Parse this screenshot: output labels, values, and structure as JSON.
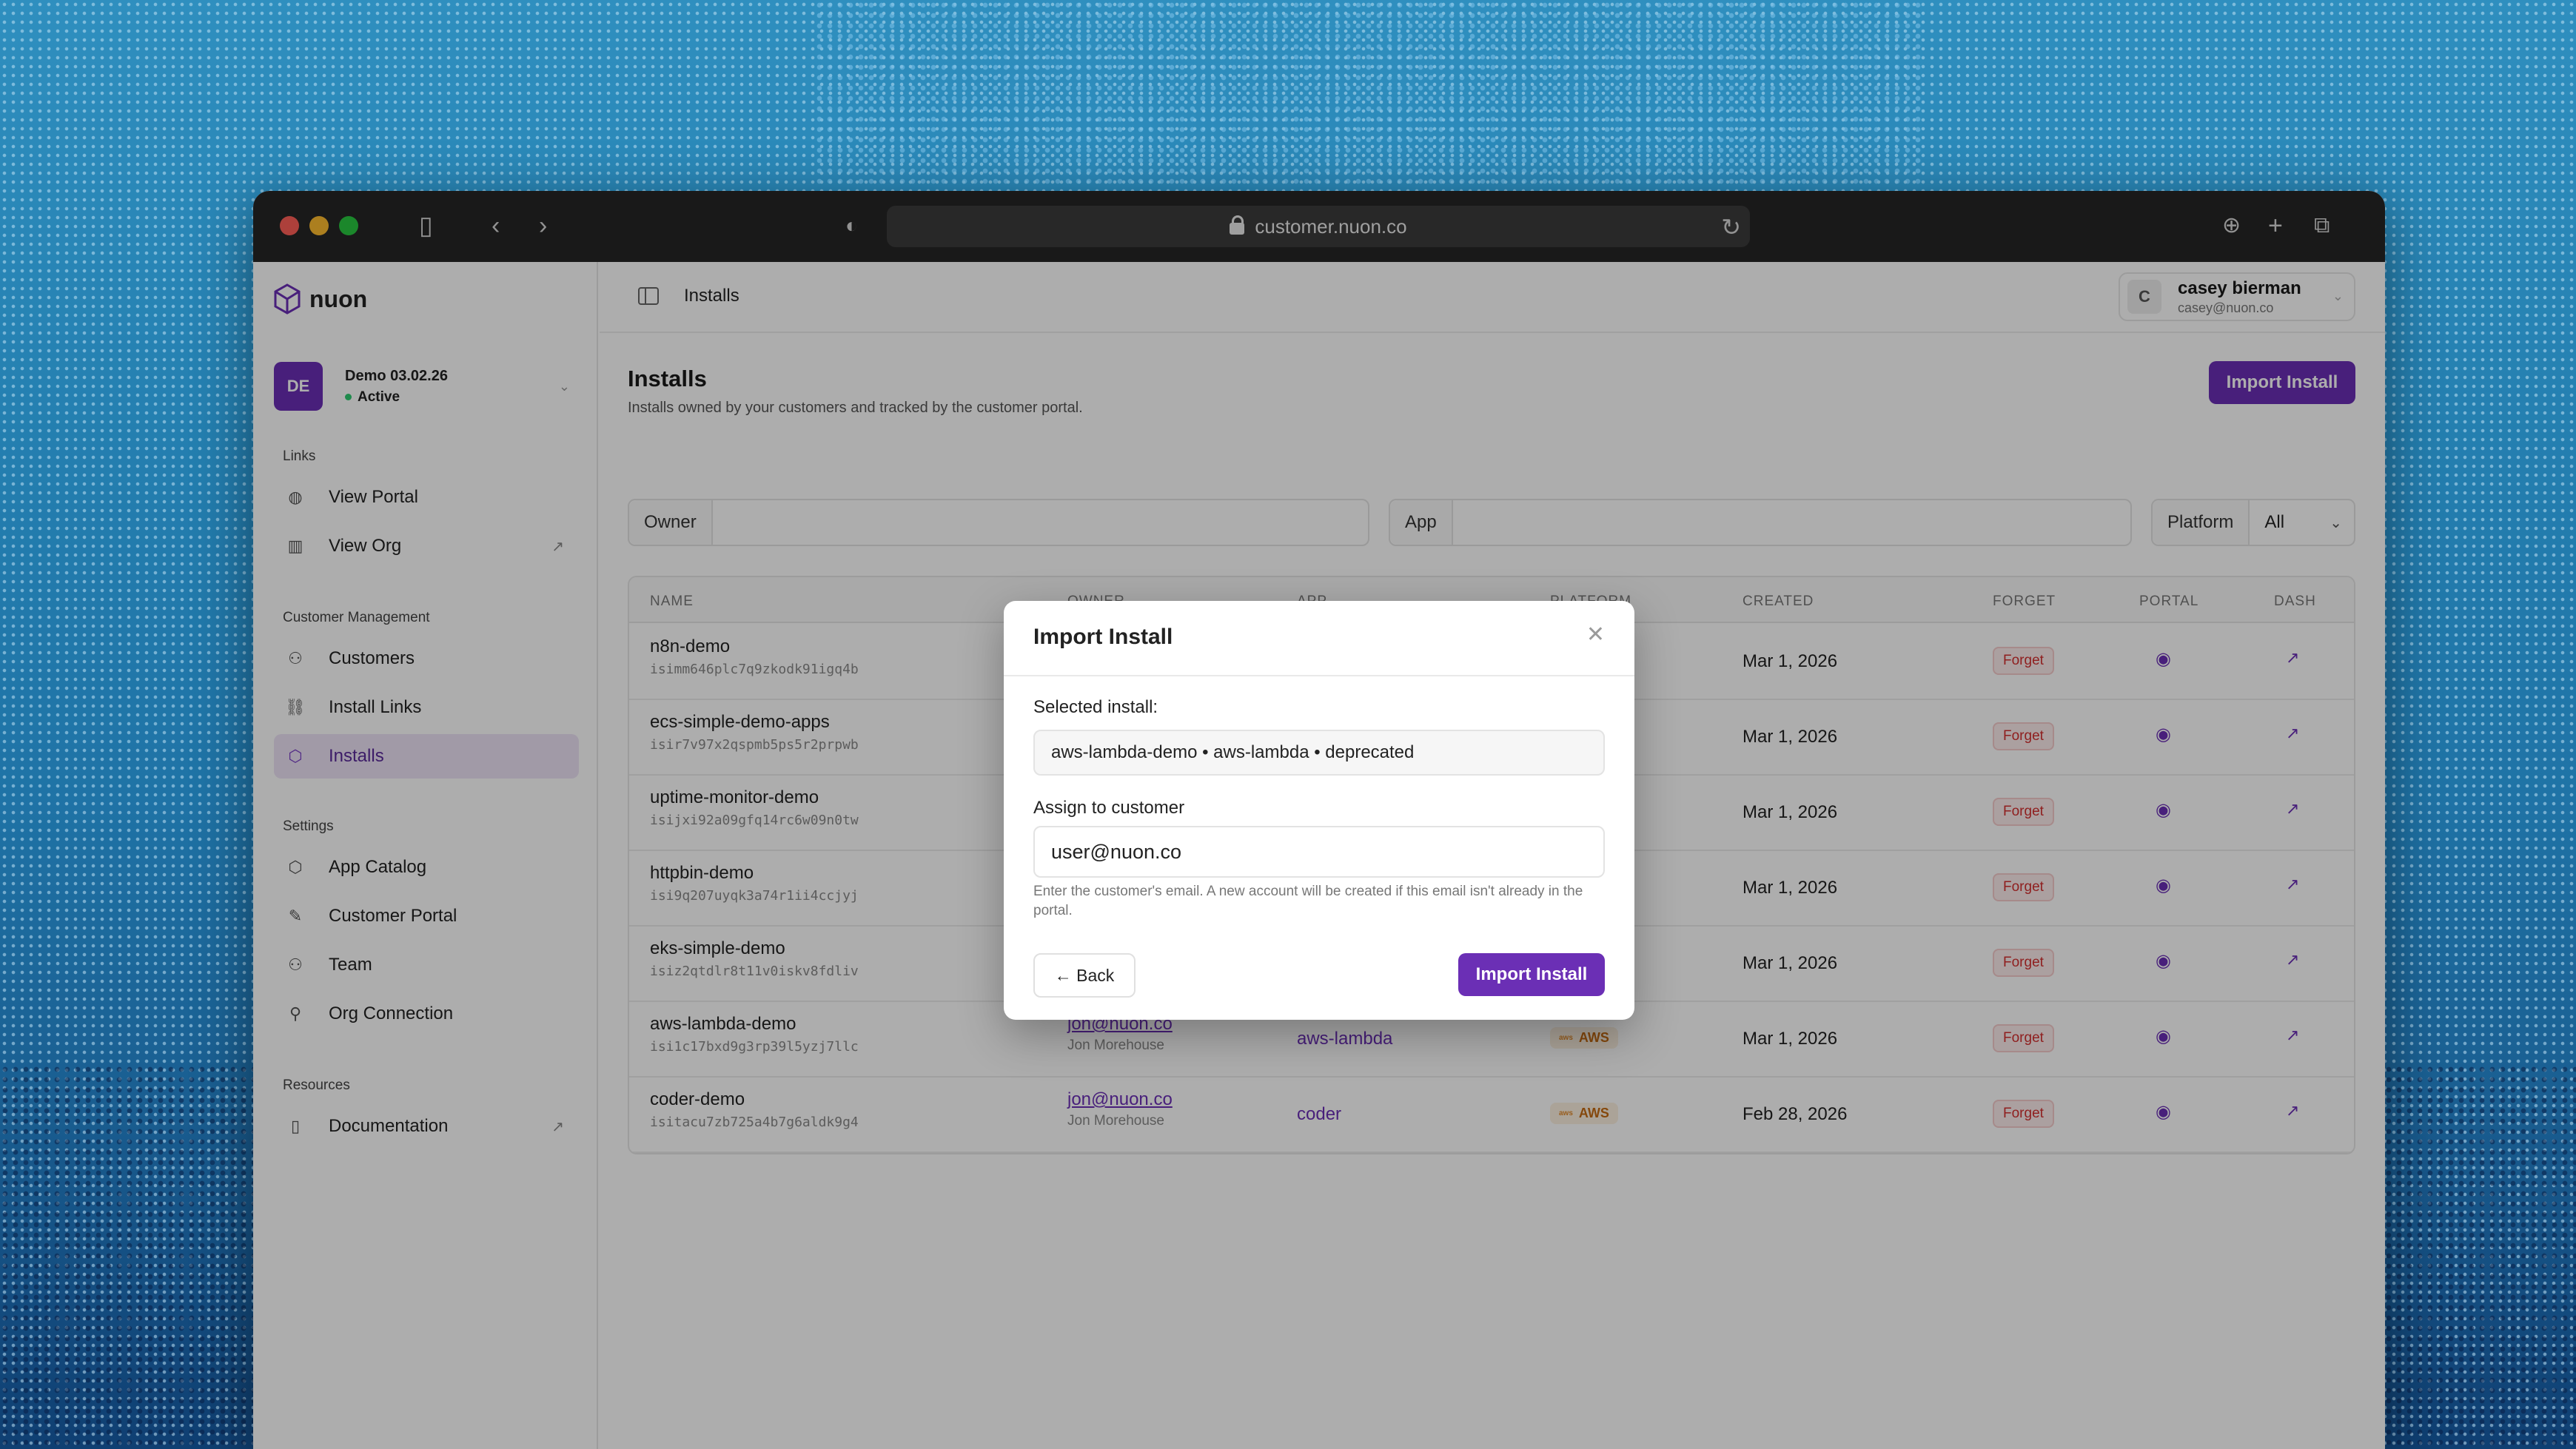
{
  "browser": {
    "url": "customer.nuon.co"
  },
  "sidebar": {
    "brand": "nuon",
    "org": {
      "initials": "DE",
      "name": "Demo 03.02.26",
      "status": "Active"
    },
    "sections": {
      "links": "Links",
      "customer_management": "Customer Management",
      "settings": "Settings",
      "resources": "Resources"
    },
    "items": {
      "view_portal": "View Portal",
      "view_org": "View Org",
      "customers": "Customers",
      "install_links": "Install Links",
      "installs": "Installs",
      "app_catalog": "App Catalog",
      "customer_portal": "Customer Portal",
      "team": "Team",
      "org_connection": "Org Connection",
      "documentation": "Documentation"
    }
  },
  "header": {
    "breadcrumb": "Installs",
    "user": {
      "initial": "C",
      "name": "casey bierman",
      "email": "casey@nuon.co"
    }
  },
  "page": {
    "title": "Installs",
    "subtitle": "Installs owned by your customers and tracked by the customer portal.",
    "import_button": "Import Install",
    "filters": {
      "owner": "Owner",
      "app": "App",
      "platform": "Platform",
      "platform_value": "All"
    }
  },
  "table": {
    "columns": {
      "name": "NAME",
      "owner": "OWNER",
      "app": "APP",
      "platform": "PLATFORM",
      "created": "CREATED",
      "forget": "FORGET",
      "portal": "PORTAL",
      "dash": "DASH"
    },
    "forget_label": "Forget",
    "rows": [
      {
        "name": "n8n-demo",
        "id": "isimm646plc7q9zkodk91igq4b",
        "owner_email": "",
        "owner_name": "",
        "app": "",
        "platform": "",
        "created": "Mar 1, 2026"
      },
      {
        "name": "ecs-simple-demo-apps",
        "id": "isir7v97x2qspmb5ps5r2prpwb",
        "owner_email": "",
        "owner_name": "",
        "app": "",
        "platform": "",
        "created": "Mar 1, 2026"
      },
      {
        "name": "uptime-monitor-demo",
        "id": "isijxi92a09gfq14rc6w09n0tw",
        "owner_email": "",
        "owner_name": "",
        "app": "",
        "platform": "",
        "created": "Mar 1, 2026"
      },
      {
        "name": "httpbin-demo",
        "id": "isi9q207uyqk3a74r1ii4ccjyj",
        "owner_email": "",
        "owner_name": "",
        "app": "",
        "platform": "",
        "created": "Mar 1, 2026"
      },
      {
        "name": "eks-simple-demo",
        "id": "isiz2qtdlr8t11v0iskv8fdliv",
        "owner_email": "",
        "owner_name": "",
        "app": "",
        "platform": "",
        "created": "Mar 1, 2026"
      },
      {
        "name": "aws-lambda-demo",
        "id": "isi1c17bxd9g3rp39l5yzj7llc",
        "owner_email": "jon@nuon.co",
        "owner_name": "Jon Morehouse",
        "app": "aws-lambda",
        "platform": "AWS",
        "created": "Mar 1, 2026"
      },
      {
        "name": "coder-demo",
        "id": "isitacu7zb725a4b7g6aldk9g4",
        "owner_email": "jon@nuon.co",
        "owner_name": "Jon Morehouse",
        "app": "coder",
        "platform": "AWS",
        "created": "Feb 28, 2026"
      }
    ]
  },
  "modal": {
    "title": "Import Install",
    "selected_label": "Selected install:",
    "selected_value": "aws-lambda-demo • aws-lambda • deprecated",
    "assign_label": "Assign to customer",
    "email_value": "user@nuon.co",
    "help": "Enter the customer's email. A new account will be created if this email isn't already in the portal.",
    "back": "← Back",
    "submit": "Import Install"
  },
  "colors": {
    "accent": "#6b2fb5",
    "forget": "#d32f2f",
    "aws": "#c46a12"
  }
}
